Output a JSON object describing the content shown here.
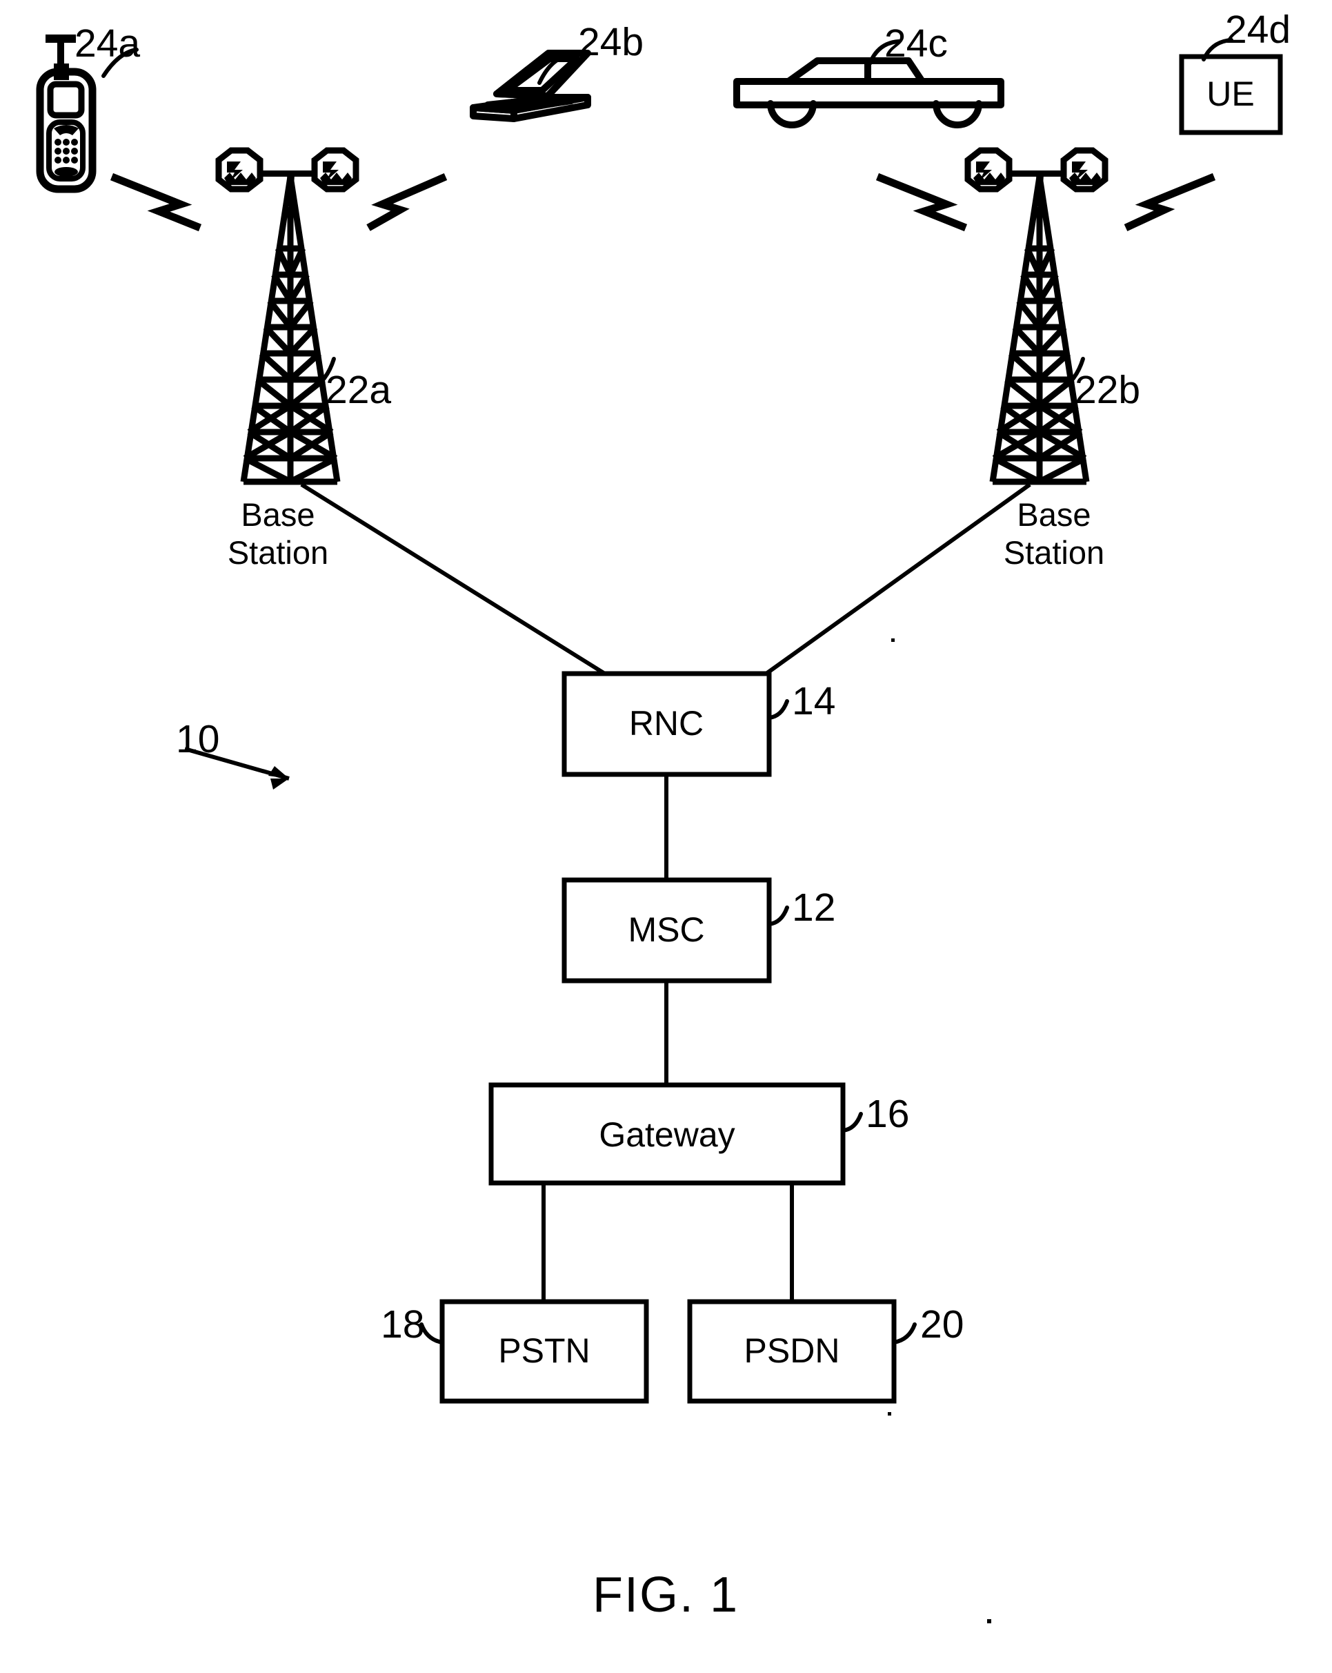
{
  "figure": {
    "caption": "FIG. 1",
    "system_reference": "10"
  },
  "devices": [
    {
      "id": "ue-a",
      "ref": "24a",
      "icon": "cell-phone-icon",
      "label": ""
    },
    {
      "id": "ue-b",
      "ref": "24b",
      "icon": "laptop-icon",
      "label": ""
    },
    {
      "id": "ue-c",
      "ref": "24c",
      "icon": "car-icon",
      "label": ""
    },
    {
      "id": "ue-d",
      "ref": "24d",
      "icon": "ue-box-icon",
      "label": "UE"
    }
  ],
  "base_stations": [
    {
      "id": "bs-a",
      "ref": "22a",
      "label_line1": "Base",
      "label_line2": "Station"
    },
    {
      "id": "bs-b",
      "ref": "22b",
      "label_line1": "Base",
      "label_line2": "Station"
    }
  ],
  "network_nodes": [
    {
      "id": "rnc",
      "label": "RNC",
      "ref": "14"
    },
    {
      "id": "msc",
      "label": "MSC",
      "ref": "12"
    },
    {
      "id": "gateway",
      "label": "Gateway",
      "ref": "16"
    },
    {
      "id": "pstn",
      "label": "PSTN",
      "ref": "18"
    },
    {
      "id": "psdn",
      "label": "PSDN",
      "ref": "20"
    }
  ],
  "colors": {
    "ink": "#000000",
    "paper": "#ffffff"
  }
}
